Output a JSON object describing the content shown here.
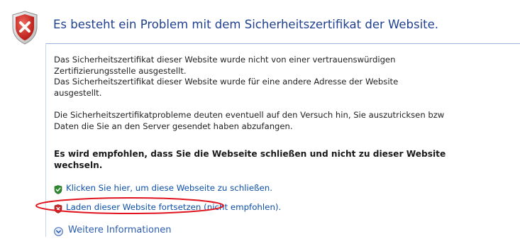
{
  "title": "Es besteht ein Problem mit dem Sicherheitszertifikat der Website.",
  "para1": [
    "Das Sicherheitszertifikat dieser Website wurde nicht von einer vertrauenswürdigen",
    "Zertifizierungsstelle ausgestellt.",
    "Das Sicherheitszertifikat dieser Website wurde für eine andere Adresse der Website",
    "ausgestellt."
  ],
  "para2": [
    "Die Sicherheitszertifikatprobleme deuten eventuell auf den Versuch hin, Sie auszutricksen bzw",
    "Daten die Sie an den Server gesendet haben abzufangen."
  ],
  "recommendation": [
    "Es wird empfohlen, dass Sie die Webseite schließen und nicht zu dieser Website",
    "wechseln."
  ],
  "links": {
    "close": "Klicken Sie hier, um diese Webseite zu schließen.",
    "continue": "Laden dieser Website fortsetzen (nicht empfohlen).",
    "more_info": "Weitere Informationen"
  },
  "colors": {
    "title": "#1f3f8f",
    "link": "#0b4fa8",
    "shield_red": "#c62828",
    "ok_green": "#2e8b2e",
    "annotation_red": "#e0141e"
  },
  "icons": {
    "main": "shield-error-icon",
    "close_link": "green-shield-check-icon",
    "continue_link": "red-shield-x-icon",
    "more_info": "chevron-down-circle-icon"
  }
}
